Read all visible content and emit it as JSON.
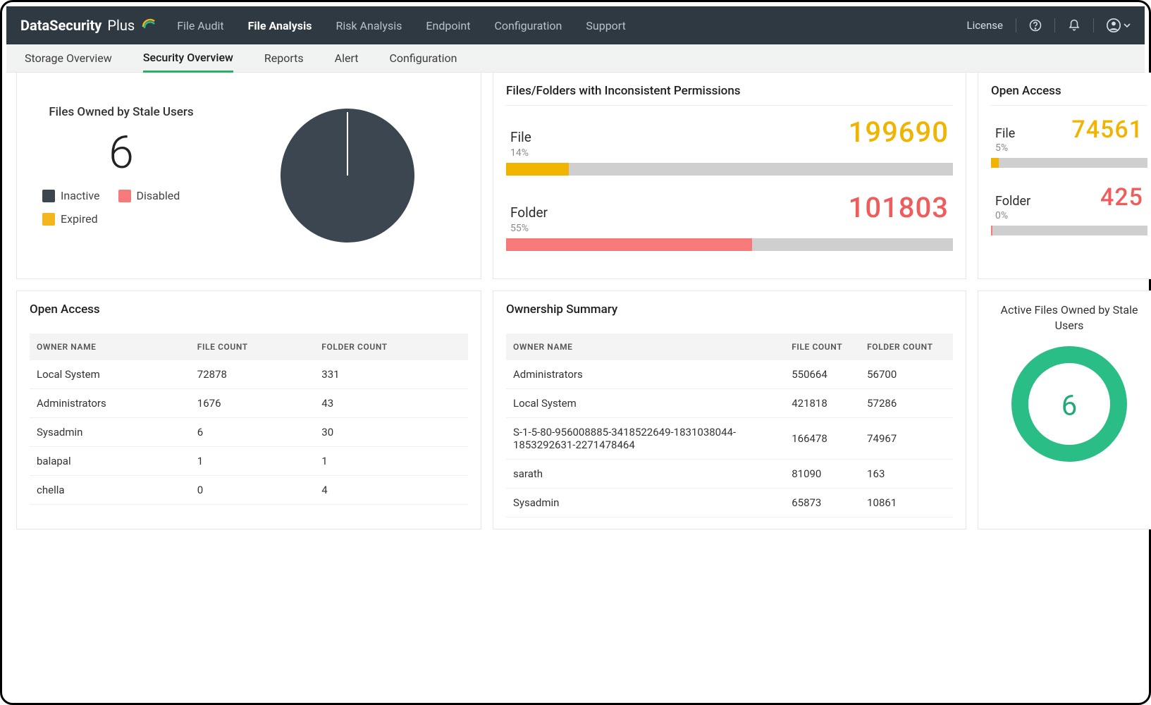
{
  "brand": {
    "part1": "DataSecurity",
    "part2": "Plus"
  },
  "topnav": {
    "items": [
      {
        "label": "File Audit"
      },
      {
        "label": "File Analysis",
        "active": true
      },
      {
        "label": "Risk Analysis"
      },
      {
        "label": "Endpoint"
      },
      {
        "label": "Configuration"
      },
      {
        "label": "Support"
      }
    ],
    "license": "License"
  },
  "subnav": {
    "items": [
      {
        "label": "Storage Overview"
      },
      {
        "label": "Security Overview",
        "active": true
      },
      {
        "label": "Reports"
      },
      {
        "label": "Alert"
      },
      {
        "label": "Configuration"
      }
    ]
  },
  "stale_users_card": {
    "title": "Files Owned by Stale Users",
    "count": "6",
    "legend": {
      "inactive": "Inactive",
      "disabled": "Disabled",
      "expired": "Expired"
    }
  },
  "inconsistent": {
    "title": "Files/Folders with Inconsistent Permissions",
    "file": {
      "label": "File",
      "value": "199690",
      "pct": "14%",
      "pct_num": 14
    },
    "folder": {
      "label": "Folder",
      "value": "101803",
      "pct": "55%",
      "pct_num": 55
    }
  },
  "open_access_small": {
    "title": "Open Access",
    "file": {
      "label": "File",
      "value": "74561",
      "pct": "5%",
      "pct_num": 5
    },
    "folder": {
      "label": "Folder",
      "value": "425",
      "pct": "0%",
      "pct_num": 0
    }
  },
  "open_access_table": {
    "title": "Open Access",
    "headers": {
      "owner": "OWNER NAME",
      "files": "FILE COUNT",
      "folders": "FOLDER COUNT"
    },
    "rows": [
      {
        "owner": "Local System",
        "files": "72878",
        "folders": "331"
      },
      {
        "owner": "Administrators",
        "files": "1676",
        "folders": "43"
      },
      {
        "owner": "Sysadmin",
        "files": "6",
        "folders": "30"
      },
      {
        "owner": "balapal",
        "files": "1",
        "folders": "1"
      },
      {
        "owner": "chella",
        "files": "0",
        "folders": "4"
      }
    ]
  },
  "ownership": {
    "title": "Ownership Summary",
    "headers": {
      "owner": "OWNER NAME",
      "files": "FILE COUNT",
      "folders": "FOLDER COUNT"
    },
    "rows": [
      {
        "owner": "Administrators",
        "files": "550664",
        "folders": "56700"
      },
      {
        "owner": "Local System",
        "files": "421818",
        "folders": "57286"
      },
      {
        "owner": "S-1-5-80-956008885-3418522649-1831038044-1853292631-2271478464",
        "files": "166478",
        "folders": "74967"
      },
      {
        "owner": "sarath",
        "files": "81090",
        "folders": "163"
      },
      {
        "owner": "Sysadmin",
        "files": "65873",
        "folders": "10861"
      }
    ]
  },
  "active_stale": {
    "title": "Active Files Owned by Stale Users",
    "value": "6"
  },
  "chart_data": [
    {
      "type": "pie",
      "title": "Files Owned by Stale Users",
      "categories": [
        "Inactive",
        "Disabled",
        "Expired"
      ],
      "values": [
        6,
        0,
        0
      ],
      "colors": [
        "#3c4650",
        "#f77a7a",
        "#f3b61f"
      ]
    },
    {
      "type": "bar",
      "title": "Files/Folders with Inconsistent Permissions",
      "orientation": "horizontal",
      "categories": [
        "File",
        "Folder"
      ],
      "values": [
        199690,
        101803
      ],
      "percentages": [
        14,
        55
      ],
      "colors": [
        "#f0b400",
        "#f77a7a"
      ]
    },
    {
      "type": "bar",
      "title": "Open Access",
      "orientation": "horizontal",
      "categories": [
        "File",
        "Folder"
      ],
      "values": [
        74561,
        425
      ],
      "percentages": [
        5,
        0
      ],
      "colors": [
        "#f0b400",
        "#ef5c5c"
      ]
    },
    {
      "type": "pie",
      "title": "Active Files Owned by Stale Users",
      "subtype": "donut",
      "values": [
        6
      ],
      "colors": [
        "#2bbd86"
      ]
    }
  ]
}
